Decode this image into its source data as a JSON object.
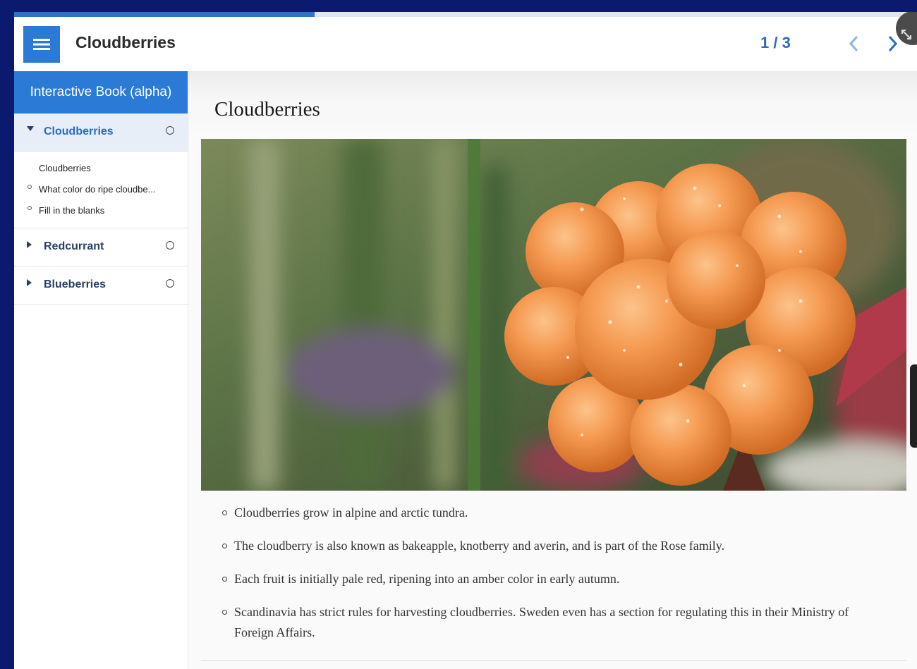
{
  "header": {
    "title": "Cloudberries",
    "page_counter": "1 / 3",
    "progress_fraction": 0.333,
    "accent": "#2a7ad6"
  },
  "sidebar": {
    "heading": "Interactive Book (alpha)",
    "chapters": [
      {
        "label": "Cloudberries",
        "expanded": true,
        "active": true
      },
      {
        "label": "Redcurrant",
        "expanded": false
      },
      {
        "label": "Blueberries",
        "expanded": false
      }
    ],
    "subitems": [
      {
        "label": "Cloudberries"
      },
      {
        "label": "What color do ripe cloudbe..."
      },
      {
        "label": "Fill in the blanks"
      }
    ]
  },
  "main": {
    "heading": "Cloudberries",
    "bullets": [
      "Cloudberries grow in alpine and arctic tundra.",
      "The cloudberry is also known as bakeapple, knotberry and averin, and is part of the Rose family.",
      "Each fruit is initially pale red, ripening into an amber color in early autumn.",
      "Scandinavia has strict rules for harvesting cloudberries. Sweden even has a section for regulating this in their Ministry of Foreign Affairs."
    ]
  },
  "icons": {
    "menu": "hamburger-icon",
    "prev": "chevron-left-icon",
    "next": "chevron-right-icon",
    "fullscreen": "expand-icon"
  }
}
